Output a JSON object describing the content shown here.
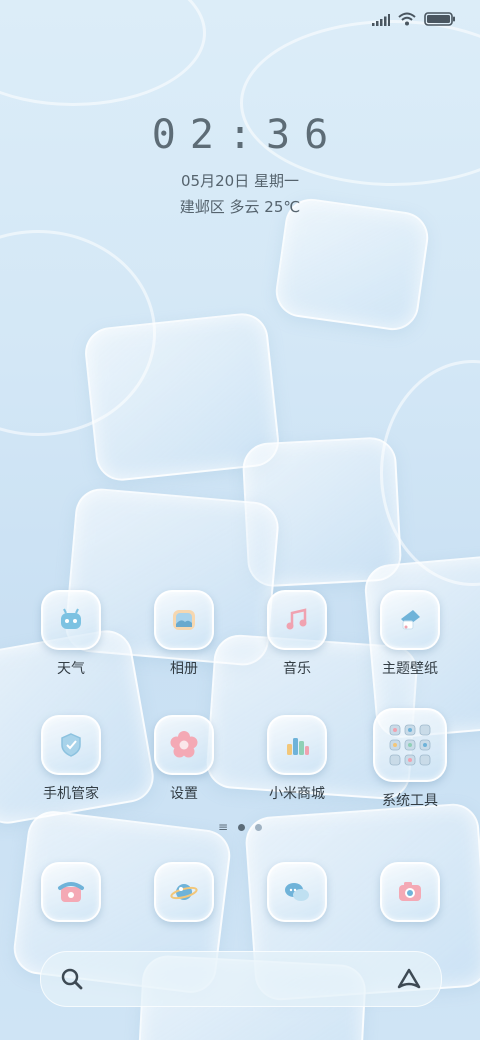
{
  "status_bar": {
    "icons": [
      "signal-icon",
      "wifi-icon",
      "battery-icon"
    ]
  },
  "lockscreen": {
    "time": "02:36",
    "date": "05月20日 星期一",
    "weather": "建邺区 多云 25℃"
  },
  "apps_row1": [
    {
      "label": "天气",
      "icon": "weather-robot-icon"
    },
    {
      "label": "相册",
      "icon": "gallery-icon"
    },
    {
      "label": "音乐",
      "icon": "music-icon"
    },
    {
      "label": "主题壁纸",
      "icon": "themes-icon"
    }
  ],
  "apps_row2": [
    {
      "label": "手机管家",
      "icon": "security-shield-icon"
    },
    {
      "label": "设置",
      "icon": "settings-flower-icon"
    },
    {
      "label": "小米商城",
      "icon": "mi-store-icon"
    },
    {
      "label": "系统工具",
      "icon": "folder-icon"
    }
  ],
  "dock": [
    {
      "icon": "phone-icon"
    },
    {
      "icon": "browser-planet-icon"
    },
    {
      "icon": "messages-icon"
    },
    {
      "icon": "camera-icon"
    }
  ],
  "pager": {
    "pages": 3,
    "current": 2
  },
  "search_bar": {
    "left_icon": "search-icon",
    "right_icon": "assistant-icon"
  },
  "colors": {
    "accent_pink": "#f0a2b0",
    "accent_blue": "#6fb3d9",
    "text": "#333d44"
  }
}
